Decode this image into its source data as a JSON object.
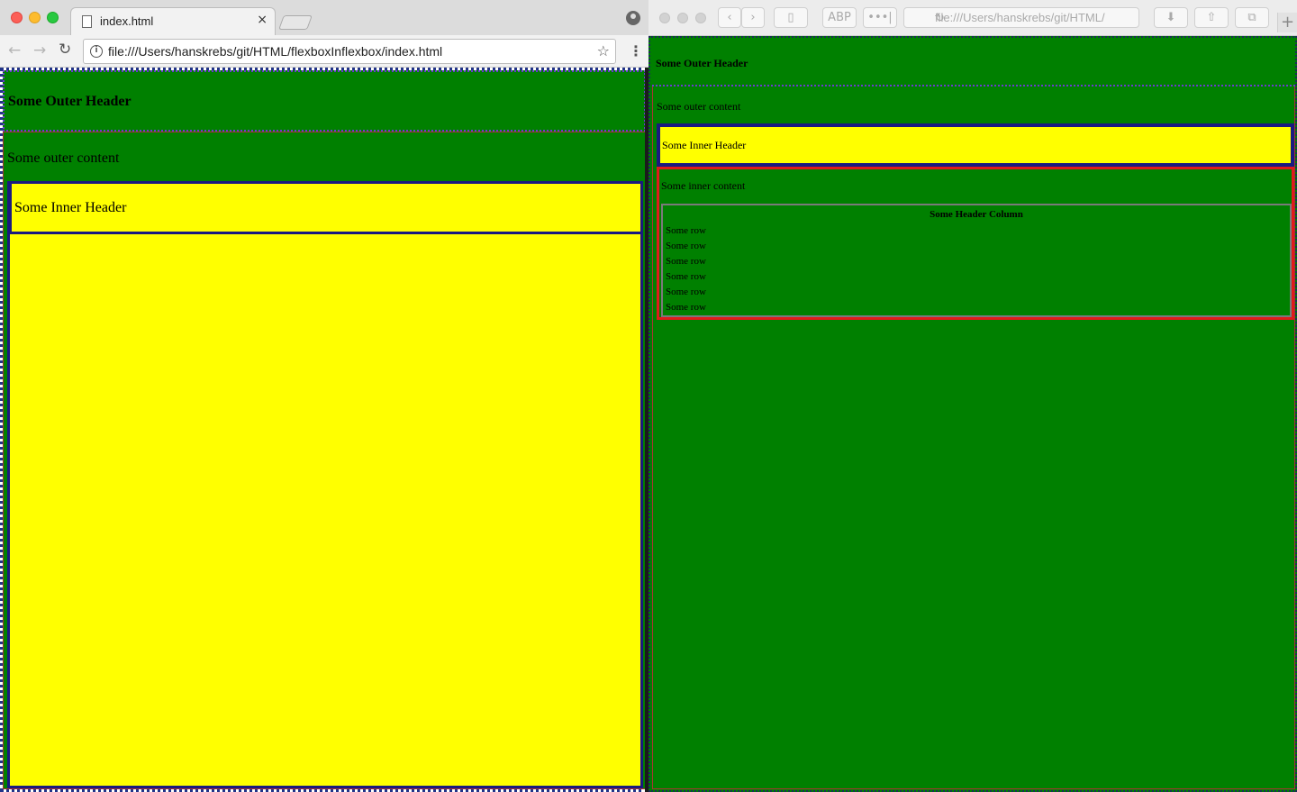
{
  "left_window": {
    "tab_title": "index.html",
    "tab_close": "×",
    "url": "file:///Users/hanskrebs/git/HTML/flexboxInflexbox/index.html",
    "info_glyph": "i",
    "star_glyph": "☆",
    "menu_glyph": "⋮",
    "back_glyph": "←",
    "forward_glyph": "→",
    "reload_glyph": "↻",
    "page": {
      "outer_header": "Some Outer Header",
      "outer_content": "Some outer content",
      "inner_header": "Some Inner Header"
    }
  },
  "right_window": {
    "url": "file:///Users/hanskrebs/git/HTML/",
    "back_glyph": "‹",
    "forward_glyph": "›",
    "abp_label": "ABP",
    "ext_glyph": "•••|",
    "reload_glyph": "↻",
    "download_glyph": "⬇",
    "share_glyph": "⇧",
    "tabs_glyph": "⧉",
    "newtab_glyph": "+",
    "page": {
      "outer_header": "Some Outer Header",
      "outer_content": "Some outer content",
      "inner_header": "Some Inner Header",
      "inner_content": "Some inner content",
      "table_header": "Some Header Column",
      "rows": [
        "Some row",
        "Some row",
        "Some row",
        "Some row",
        "Some row",
        "Some row"
      ]
    }
  },
  "colors": {
    "green": "#008000",
    "yellow": "#ffff00",
    "navy_border": "#1a1a80",
    "red_border": "#e01b1b"
  }
}
